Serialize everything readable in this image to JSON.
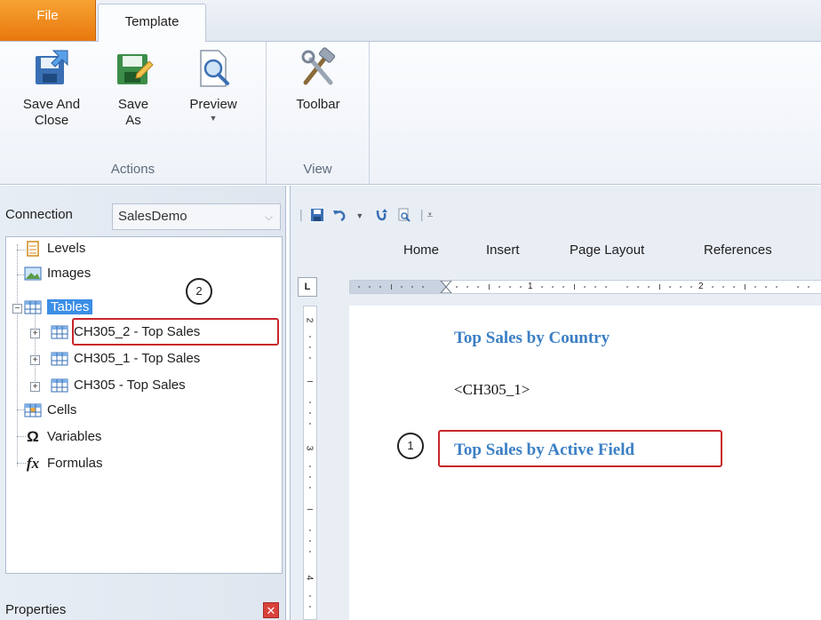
{
  "ribbon": {
    "tabs": [
      {
        "label": "File"
      },
      {
        "label": "Template"
      }
    ],
    "groups": [
      {
        "label": "Actions",
        "buttons": [
          {
            "label": "Save And\nClose",
            "icon": "save-and-close-icon"
          },
          {
            "label": "Save\nAs",
            "icon": "save-as-icon"
          },
          {
            "label": "Preview",
            "icon": "preview-icon",
            "has_dropdown": true
          }
        ]
      },
      {
        "label": "View",
        "buttons": [
          {
            "label": "Toolbar",
            "icon": "toolbar-tools-icon"
          }
        ]
      }
    ]
  },
  "left_panel": {
    "connection_label": "Connection",
    "connection_value": "SalesDemo",
    "tree": [
      {
        "label": "Levels",
        "icon": "levels-icon"
      },
      {
        "label": "Images",
        "icon": "images-icon"
      },
      {
        "label": "Tables",
        "icon": "tables-icon",
        "expanded": true,
        "selected": true
      },
      {
        "label": "CH305_2 -  Top Sales",
        "icon": "table-icon"
      },
      {
        "label": "CH305_1 -  Top Sales",
        "icon": "table-icon"
      },
      {
        "label": "CH305 -  Top Sales",
        "icon": "table-icon"
      },
      {
        "label": "Cells",
        "icon": "cells-icon"
      },
      {
        "label": "Variables",
        "icon": "omega-icon"
      },
      {
        "label": "Formulas",
        "icon": "fx-icon"
      }
    ],
    "properties_label": "Properties"
  },
  "callouts": {
    "one": "1",
    "two": "2"
  },
  "editor": {
    "tabs": [
      {
        "label": "Home"
      },
      {
        "label": "Insert"
      },
      {
        "label": "Page Layout"
      },
      {
        "label": "References"
      }
    ],
    "ruler_corner": "L",
    "ruler_marks": [
      "1",
      "2"
    ],
    "vruler_marks": [
      "2",
      "3",
      "4"
    ],
    "document": {
      "heading1": "Top Sales by Country",
      "placeholder": "<CH305_1>",
      "heading2": "Top Sales by Active Field"
    }
  },
  "colors": {
    "file_tab": "#e8780d",
    "selection": "#3a8ee6",
    "highlight_box": "#c8262c",
    "heading": "#3b7fc4"
  }
}
